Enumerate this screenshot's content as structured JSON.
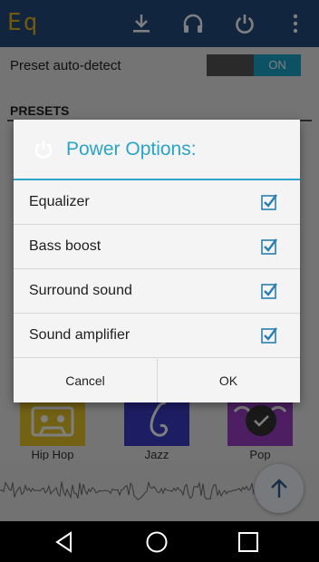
{
  "app": {
    "logo": "Eq",
    "toolbar": {
      "download_icon": "download-icon",
      "headphones_icon": "headphones-icon",
      "power_icon": "power-icon",
      "more_icon": "more-vert-icon"
    },
    "preset_autodetect": {
      "label": "Preset auto-detect",
      "toggle": "ON"
    },
    "presets_heading": "PRESETS",
    "presets": [
      {
        "name": "Hip Hop",
        "color": "#e6c229"
      },
      {
        "name": "Jazz",
        "color": "#3a3ac8"
      },
      {
        "name": "Pop",
        "color": "#9b3fc4"
      }
    ]
  },
  "dialog": {
    "title": "Power Options:",
    "accent": "#2aa4c8",
    "options": [
      {
        "label": "Equalizer",
        "checked": true
      },
      {
        "label": "Bass boost",
        "checked": true
      },
      {
        "label": "Surround sound",
        "checked": true
      },
      {
        "label": "Sound amplifier",
        "checked": true
      }
    ],
    "cancel_label": "Cancel",
    "ok_label": "OK"
  },
  "navbar": {
    "back_icon": "back-triangle-icon",
    "home_icon": "home-circle-icon",
    "recents_icon": "recents-square-icon"
  }
}
